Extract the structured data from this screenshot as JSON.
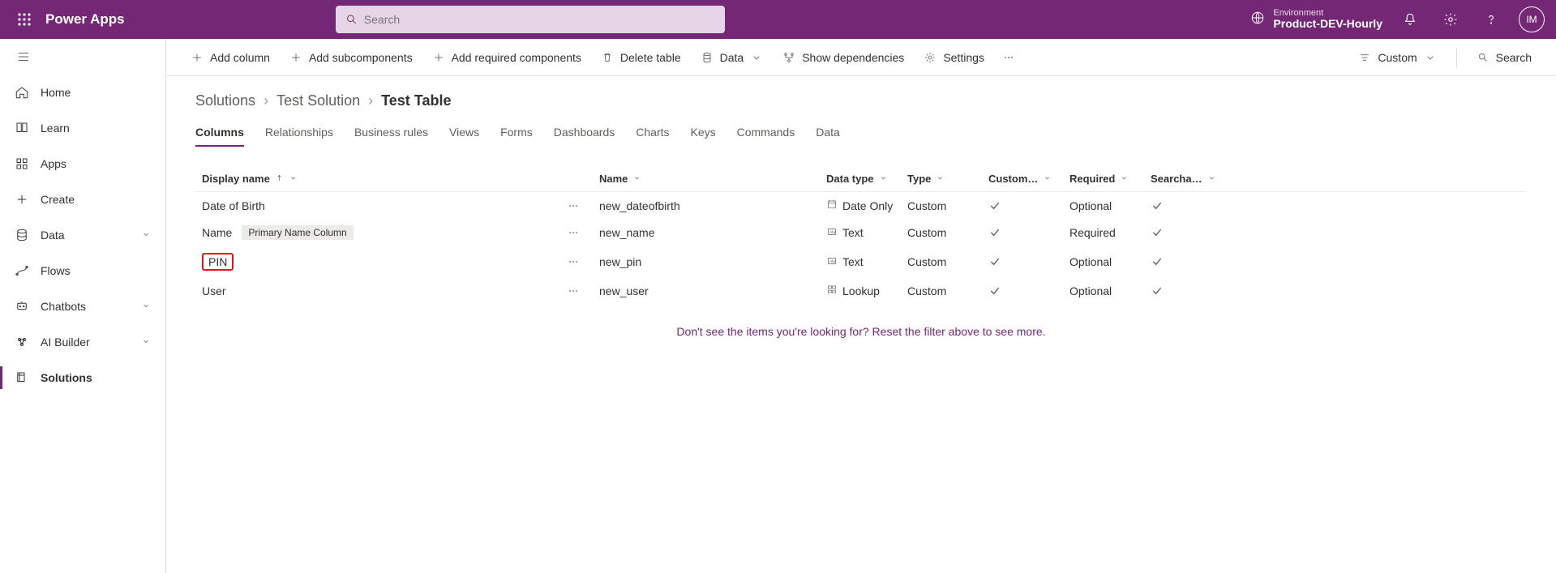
{
  "brand": "Power Apps",
  "search": {
    "placeholder": "Search"
  },
  "env": {
    "label": "Environment",
    "name": "Product-DEV-Hourly"
  },
  "avatar": "IM",
  "sidebar": {
    "items": [
      {
        "label": "Home"
      },
      {
        "label": "Learn"
      },
      {
        "label": "Apps"
      },
      {
        "label": "Create"
      },
      {
        "label": "Data"
      },
      {
        "label": "Flows"
      },
      {
        "label": "Chatbots"
      },
      {
        "label": "AI Builder"
      },
      {
        "label": "Solutions"
      }
    ]
  },
  "cmdbar": {
    "add_column": "Add column",
    "add_subcomponents": "Add subcomponents",
    "add_required": "Add required components",
    "delete_table": "Delete table",
    "data": "Data",
    "show_deps": "Show dependencies",
    "settings": "Settings",
    "custom": "Custom",
    "search": "Search"
  },
  "breadcrumb": {
    "a": "Solutions",
    "b": "Test Solution",
    "c": "Test Table"
  },
  "tabs": [
    "Columns",
    "Relationships",
    "Business rules",
    "Views",
    "Forms",
    "Dashboards",
    "Charts",
    "Keys",
    "Commands",
    "Data"
  ],
  "active_tab": 0,
  "columns": {
    "headers": {
      "display": "Display name",
      "name": "Name",
      "datatype": "Data type",
      "type": "Type",
      "custom": "Custom…",
      "required": "Required",
      "search": "Searcha…"
    },
    "rows": [
      {
        "display": "Date of Birth",
        "name": "new_dateofbirth",
        "datatype": "Date Only",
        "type": "Custom",
        "custom": true,
        "required": "Optional",
        "search": true,
        "badge": "",
        "highlight": false
      },
      {
        "display": "Name",
        "name": "new_name",
        "datatype": "Text",
        "type": "Custom",
        "custom": true,
        "required": "Required",
        "search": true,
        "badge": "Primary Name Column",
        "highlight": false
      },
      {
        "display": "PIN",
        "name": "new_pin",
        "datatype": "Text",
        "type": "Custom",
        "custom": true,
        "required": "Optional",
        "search": true,
        "badge": "",
        "highlight": true
      },
      {
        "display": "User",
        "name": "new_user",
        "datatype": "Lookup",
        "type": "Custom",
        "custom": true,
        "required": "Optional",
        "search": true,
        "badge": "",
        "highlight": false
      }
    ]
  },
  "footer": "Don't see the items you're looking for? Reset the filter above to see more."
}
